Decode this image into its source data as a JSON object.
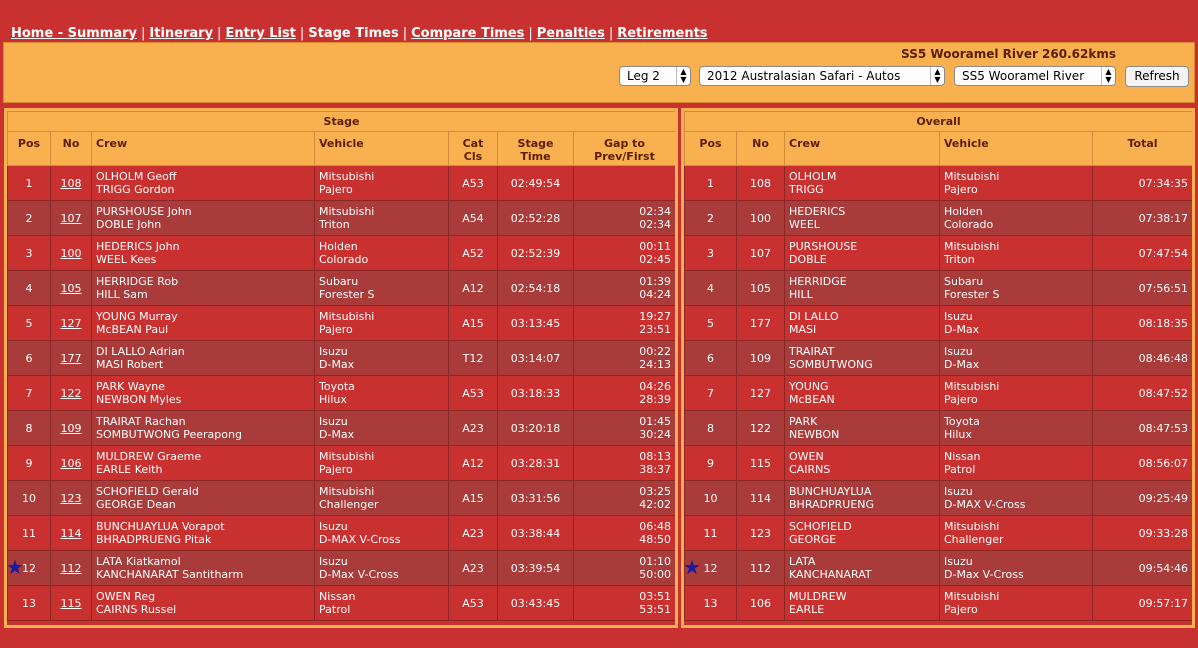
{
  "nav": {
    "items": [
      {
        "label": "Home - Summary",
        "link": true
      },
      {
        "label": "Itinerary",
        "link": true
      },
      {
        "label": "Entry List",
        "link": true
      },
      {
        "label": "Stage Times",
        "link": false
      },
      {
        "label": "Compare Times",
        "link": true
      },
      {
        "label": "Penalties",
        "link": true
      },
      {
        "label": "Retirements",
        "link": true
      }
    ]
  },
  "controls": {
    "stage_title": "SS5 Wooramel River 260.62kms",
    "leg_select": "Leg 2",
    "event_select": "2012 Australasian Safari - Autos",
    "stage_select": "SS5 Wooramel River",
    "refresh_label": "Refresh"
  },
  "stage": {
    "group_header": "Stage",
    "headers": {
      "pos": "Pos",
      "no": "No",
      "crew": "Crew",
      "vehicle": "Vehicle",
      "cat1": "Cat",
      "cat2": "Cls",
      "time1": "Stage",
      "time2": "Time",
      "gap1": "Gap to",
      "gap2": "Prev/First"
    },
    "rows": [
      {
        "pos": "1",
        "no": "108",
        "crew1": "OLHOLM Geoff",
        "crew2": "TRIGG Gordon",
        "veh1": "Mitsubishi",
        "veh2": "Pajero",
        "cat": "A53",
        "time": "02:49:54",
        "gap1": "",
        "gap2": ""
      },
      {
        "pos": "2",
        "no": "107",
        "crew1": "PURSHOUSE John",
        "crew2": "DOBLE John",
        "veh1": "Mitsubishi",
        "veh2": "Triton",
        "cat": "A54",
        "time": "02:52:28",
        "gap1": "02:34",
        "gap2": "02:34"
      },
      {
        "pos": "3",
        "no": "100",
        "crew1": "HEDERICS John",
        "crew2": "WEEL Kees",
        "veh1": "Holden",
        "veh2": "Colorado",
        "cat": "A52",
        "time": "02:52:39",
        "gap1": "00:11",
        "gap2": "02:45"
      },
      {
        "pos": "4",
        "no": "105",
        "crew1": "HERRIDGE Rob",
        "crew2": "HILL Sam",
        "veh1": "Subaru",
        "veh2": "Forester S",
        "cat": "A12",
        "time": "02:54:18",
        "gap1": "01:39",
        "gap2": "04:24"
      },
      {
        "pos": "5",
        "no": "127",
        "crew1": "YOUNG Murray",
        "crew2": "McBEAN Paul",
        "veh1": "Mitsubishi",
        "veh2": "Pajero",
        "cat": "A15",
        "time": "03:13:45",
        "gap1": "19:27",
        "gap2": "23:51"
      },
      {
        "pos": "6",
        "no": "177",
        "crew1": "DI LALLO Adrian",
        "crew2": "MASI Robert",
        "veh1": "Isuzu",
        "veh2": "D-Max",
        "cat": "T12",
        "time": "03:14:07",
        "gap1": "00:22",
        "gap2": "24:13"
      },
      {
        "pos": "7",
        "no": "122",
        "crew1": "PARK Wayne",
        "crew2": "NEWBON Myles",
        "veh1": "Toyota",
        "veh2": "Hilux",
        "cat": "A53",
        "time": "03:18:33",
        "gap1": "04:26",
        "gap2": "28:39"
      },
      {
        "pos": "8",
        "no": "109",
        "crew1": "TRAIRAT Rachan",
        "crew2": "SOMBUTWONG Peerapong",
        "veh1": "Isuzu",
        "veh2": "D-Max",
        "cat": "A23",
        "time": "03:20:18",
        "gap1": "01:45",
        "gap2": "30:24"
      },
      {
        "pos": "9",
        "no": "106",
        "crew1": "MULDREW Graeme",
        "crew2": "EARLE Keith",
        "veh1": "Mitsubishi",
        "veh2": "Pajero",
        "cat": "A12",
        "time": "03:28:31",
        "gap1": "08:13",
        "gap2": "38:37"
      },
      {
        "pos": "10",
        "no": "123",
        "crew1": "SCHOFIELD Gerald",
        "crew2": "GEORGE Dean",
        "veh1": "Mitsubishi",
        "veh2": "Challenger",
        "cat": "A15",
        "time": "03:31:56",
        "gap1": "03:25",
        "gap2": "42:02"
      },
      {
        "pos": "11",
        "no": "114",
        "crew1": "BUNCHUAYLUA Vorapot",
        "crew2": "BHRADPRUENG Pitak",
        "veh1": "Isuzu",
        "veh2": "D-MAX V-Cross",
        "cat": "A23",
        "time": "03:38:44",
        "gap1": "06:48",
        "gap2": "48:50"
      },
      {
        "pos": "12",
        "no": "112",
        "crew1": "LATA Kiatkamol",
        "crew2": "KANCHANARAT Santitharm",
        "veh1": "Isuzu",
        "veh2": "D-Max V-Cross",
        "cat": "A23",
        "time": "03:39:54",
        "gap1": "01:10",
        "gap2": "50:00",
        "star": true
      },
      {
        "pos": "13",
        "no": "115",
        "crew1": "OWEN Reg",
        "crew2": "CAIRNS Russel",
        "veh1": "Nissan",
        "veh2": "Patrol",
        "cat": "A53",
        "time": "03:43:45",
        "gap1": "03:51",
        "gap2": "53:51"
      }
    ]
  },
  "overall": {
    "group_header": "Overall",
    "headers": {
      "pos": "Pos",
      "no": "No",
      "crew": "Crew",
      "vehicle": "Vehicle",
      "total": "Total"
    },
    "rows": [
      {
        "pos": "1",
        "no": "108",
        "crew1": "OLHOLM",
        "crew2": "TRIGG",
        "veh1": "Mitsubishi",
        "veh2": "Pajero",
        "total": "07:34:35"
      },
      {
        "pos": "2",
        "no": "100",
        "crew1": "HEDERICS",
        "crew2": "WEEL",
        "veh1": "Holden",
        "veh2": "Colorado",
        "total": "07:38:17"
      },
      {
        "pos": "3",
        "no": "107",
        "crew1": "PURSHOUSE",
        "crew2": "DOBLE",
        "veh1": "Mitsubishi",
        "veh2": "Triton",
        "total": "07:47:54"
      },
      {
        "pos": "4",
        "no": "105",
        "crew1": "HERRIDGE",
        "crew2": "HILL",
        "veh1": "Subaru",
        "veh2": "Forester S",
        "total": "07:56:51"
      },
      {
        "pos": "5",
        "no": "177",
        "crew1": "DI LALLO",
        "crew2": "MASI",
        "veh1": "Isuzu",
        "veh2": "D-Max",
        "total": "08:18:35"
      },
      {
        "pos": "6",
        "no": "109",
        "crew1": "TRAIRAT",
        "crew2": "SOMBUTWONG",
        "veh1": "Isuzu",
        "veh2": "D-Max",
        "total": "08:46:48"
      },
      {
        "pos": "7",
        "no": "127",
        "crew1": "YOUNG",
        "crew2": "McBEAN",
        "veh1": "Mitsubishi",
        "veh2": "Pajero",
        "total": "08:47:52"
      },
      {
        "pos": "8",
        "no": "122",
        "crew1": "PARK",
        "crew2": "NEWBON",
        "veh1": "Toyota",
        "veh2": "Hilux",
        "total": "08:47:53"
      },
      {
        "pos": "9",
        "no": "115",
        "crew1": "OWEN",
        "crew2": "CAIRNS",
        "veh1": "Nissan",
        "veh2": "Patrol",
        "total": "08:56:07"
      },
      {
        "pos": "10",
        "no": "114",
        "crew1": "BUNCHUAYLUA",
        "crew2": "BHRADPRUENG",
        "veh1": "Isuzu",
        "veh2": "D-MAX V-Cross",
        "total": "09:25:49"
      },
      {
        "pos": "11",
        "no": "123",
        "crew1": "SCHOFIELD",
        "crew2": "GEORGE",
        "veh1": "Mitsubishi",
        "veh2": "Challenger",
        "total": "09:33:28"
      },
      {
        "pos": "12",
        "no": "112",
        "crew1": "LATA",
        "crew2": "KANCHANARAT",
        "veh1": "Isuzu",
        "veh2": "D-Max V-Cross",
        "total": "09:54:46",
        "star": true
      },
      {
        "pos": "13",
        "no": "106",
        "crew1": "MULDREW",
        "crew2": "EARLE",
        "veh1": "Mitsubishi",
        "veh2": "Pajero",
        "total": "09:57:17"
      }
    ]
  },
  "icons": {
    "star": "star-icon",
    "dropdown": "chevron-updown-icon"
  },
  "colors": {
    "background": "#c8312f",
    "header": "#f9b04e",
    "row_alt": "#a93c3a",
    "star": "#1a1aa0"
  }
}
